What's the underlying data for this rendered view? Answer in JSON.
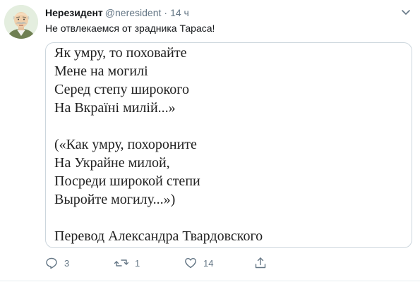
{
  "tweet": {
    "display_name": "Нерезидент",
    "handle": "@neresident",
    "separator": "·",
    "time": "14 ч",
    "text": "Не отвлекаемся от зрадника Тараса!",
    "image_lines": [
      "Як умру, то поховайте",
      "Мене на могилі",
      "Серед степу широкого",
      "На Вкраїні милій...»",
      "",
      "(«Как умру, похороните",
      "На Украйне милой,",
      "Посреди широкой степи",
      "Выройте могилу...»)",
      "",
      "Перевод Александра Твардовского"
    ],
    "actions": {
      "reply_count": "3",
      "retweet_count": "1",
      "like_count": "14",
      "reply_icon": "reply-icon",
      "retweet_icon": "retweet-icon",
      "like_icon": "heart-icon",
      "share_icon": "share-icon"
    }
  },
  "colors": {
    "text_primary": "#14171a",
    "text_secondary": "#657786",
    "border": "#ccd6dd"
  }
}
